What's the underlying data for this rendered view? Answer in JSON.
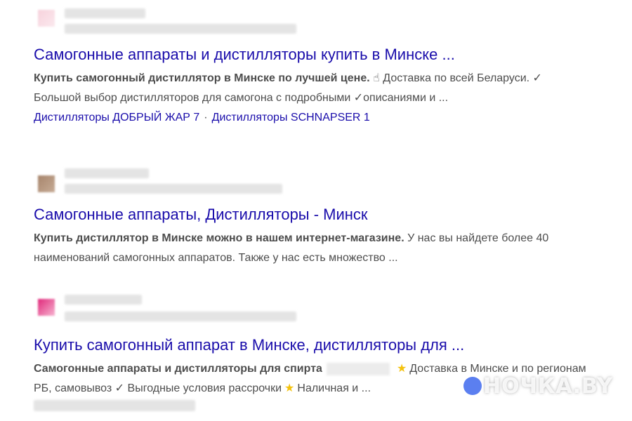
{
  "results": [
    {
      "title": "Самогонные аппараты и дистилляторы купить в Минске ...",
      "snippet_bold": "Купить самогонный дистиллятор в Минске по лучшей цене.",
      "snippet_emoji": "☝",
      "snippet_rest1": " Доставка по всей Беларуси. ✓",
      "snippet_rest2": "Большой выбор дистилляторов для самогона с подробными ✓описаниями и ...",
      "sitelinks": [
        "Дистилляторы ДОБРЫЙ ЖАР 7",
        "Дистилляторы SCHNAPSER 1"
      ],
      "sitelink_separator": "·"
    },
    {
      "title": "Самогонные аппараты, Дистилляторы - Минск",
      "snippet_bold": "Купить дистиллятор в Минске можно в нашем интернет-магазине.",
      "snippet_rest": " У нас вы найдете более 40 наименований самогонных аппаратов. Также у нас есть множество ..."
    },
    {
      "title": "Купить самогонный аппарат в Минске, дистилляторы для ...",
      "snippet_bold": "Самогонные аппараты и дистилляторы для спирта",
      "snippet_part1": "Доставка в Минске и по регионам РБ, самовывоз ✓ Выгодные условия рассрочки",
      "snippet_part2": "Наличная и ...",
      "star": "★"
    }
  ],
  "watermark": "НОЧКА.BY",
  "colors": {
    "link": "#1a0dab",
    "text": "#4d4d4d",
    "star": "#f4c20d",
    "watermark_dot": "#5b7ff0"
  }
}
